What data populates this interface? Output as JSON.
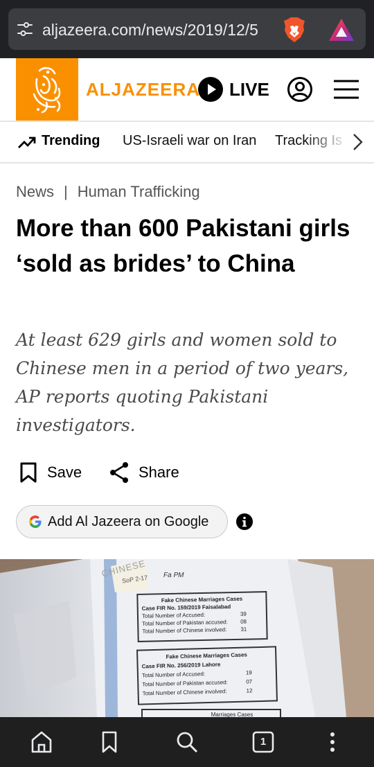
{
  "browser": {
    "url": "aljazeera.com/news/2019/12/5",
    "tune_icon": "tune-icon",
    "brave_icon": "brave-lion-icon",
    "rewards_icon": "brave-rewards-icon"
  },
  "header": {
    "logo_icon": "al-jazeera-logo",
    "brand": "ALJAZEERA",
    "live_label": "LIVE",
    "account_icon": "user-circle-icon",
    "menu_icon": "hamburger-menu-icon",
    "brand_color": "#fa9000"
  },
  "trending": {
    "label": "Trending",
    "items": [
      "US-Israeli war on Iran",
      "Tracking Is"
    ]
  },
  "article": {
    "breadcrumb": {
      "section": "News",
      "separator": "|",
      "topic": "Human Trafficking"
    },
    "headline": "More than 600 Pakistani girls ‘sold as brides’ to China",
    "subhead": "At least 629 girls and women sold to Chinese men in a period of two years, AP reports quoting Pakistani investigators.",
    "save_label": "Save",
    "share_label": "Share",
    "google_label": "Add Al Jazeera on Google"
  },
  "photo": {
    "doc_header": "CHINESE",
    "sticky_note": "SoP 2-17",
    "handwriting": "Fa PM",
    "cases": [
      {
        "title": "Fake Chinese Marriages Cases",
        "fir": "Case FIR No. 159/2019 Faisalabad",
        "rows": [
          {
            "label": "Total Number of Accused:",
            "value": "39"
          },
          {
            "label": "Total Number of Pakistan accused:",
            "value": "08"
          },
          {
            "label": "Total Number of Chinese involved:",
            "value": "31"
          }
        ]
      },
      {
        "title": "Fake Chinese Marriages Cases",
        "fir": "Case FIR No. 256/2019 Lahore",
        "rows": [
          {
            "label": "Total Number of Accused:",
            "value": "19"
          },
          {
            "label": "Total Number of Pakistan accused:",
            "value": "07"
          },
          {
            "label": "Total Number of Chinese involved:",
            "value": "12"
          }
        ]
      },
      {
        "title": "Marriages Cases"
      }
    ]
  },
  "bottom_nav": {
    "tab_count": "1",
    "icons": [
      "home-icon",
      "bookmark-icon",
      "search-icon",
      "tabs-icon",
      "more-vertical-icon"
    ]
  }
}
